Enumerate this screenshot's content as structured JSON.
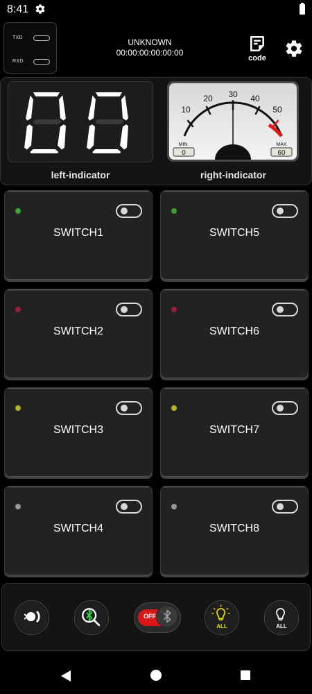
{
  "status_bar": {
    "time": "8:41"
  },
  "header": {
    "txd_label": "TXD",
    "rxd_label": "RXD",
    "device_name": "UNKNOWN",
    "device_address": "00:00:00:00:00:00",
    "code_label": "code"
  },
  "indicators": {
    "left": {
      "label": "left-indicator",
      "value": "00"
    },
    "right": {
      "label": "right-indicator",
      "scale_labels": [
        "10",
        "20",
        "30",
        "40",
        "50"
      ],
      "min_label": "MIN",
      "min_value": "0",
      "max_label": "MAX",
      "max_value": "60"
    }
  },
  "switches": [
    {
      "label": "SWITCH1",
      "led_color": "#37a42c"
    },
    {
      "label": "SWITCH2",
      "led_color": "#9c1e3c"
    },
    {
      "label": "SWITCH3",
      "led_color": "#b8b02a"
    },
    {
      "label": "SWITCH4",
      "led_color": "#9a9a9a"
    },
    {
      "label": "SWITCH5",
      "led_color": "#37a42c"
    },
    {
      "label": "SWITCH6",
      "led_color": "#9c1e3c"
    },
    {
      "label": "SWITCH7",
      "led_color": "#b8b02a"
    },
    {
      "label": "SWITCH8",
      "led_color": "#9a9a9a"
    }
  ],
  "bottom_bar": {
    "bluetooth_toggle_label": "OFF",
    "all_on_label": "ALL",
    "all_off_label": "ALL",
    "colors": {
      "toggle_red": "#d81818",
      "all_on_yellow": "#e8e000",
      "scan_green": "#2ee04a"
    }
  }
}
